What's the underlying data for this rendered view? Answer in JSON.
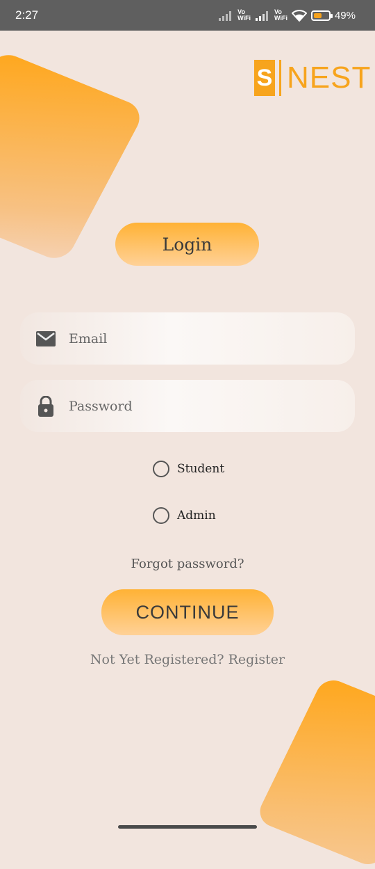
{
  "status_bar": {
    "time": "2:27",
    "vowifi_1": [
      "Vo",
      "WiFi"
    ],
    "vowifi_2": [
      "Vo",
      "WiFi"
    ],
    "battery_percent": "49%",
    "battery_level": 0.49
  },
  "logo": {
    "letter": "S",
    "name": "NEST",
    "color": "#f7a41d"
  },
  "login": {
    "title": "Login",
    "email_placeholder": "Email",
    "password_placeholder": "Password",
    "roles": [
      "Student",
      "Admin"
    ],
    "forgot_password": "Forgot password?",
    "continue_label": "CONTINUE",
    "register_text": "Not Yet Registered? Register"
  },
  "icons": {
    "email": "mail-icon",
    "password": "lock-icon"
  },
  "colors": {
    "accent": "#ffa71c",
    "background": "#f2e5de"
  }
}
